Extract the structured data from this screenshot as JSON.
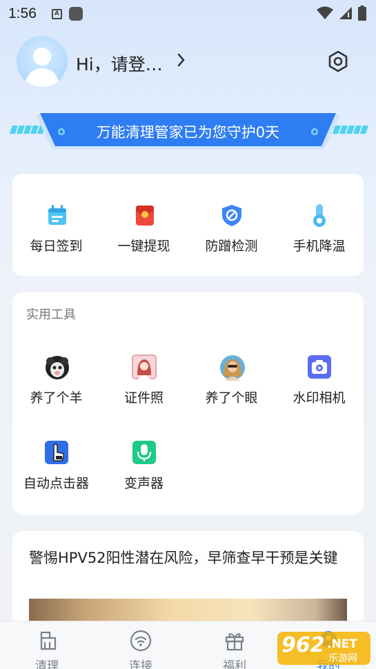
{
  "status_bar": {
    "time": "1:56",
    "notif_letter": "A"
  },
  "profile": {
    "greeting": "Hi，请登…"
  },
  "banner": {
    "text": "万能清理管家已为您守护0天"
  },
  "quick_actions": [
    {
      "label": "每日签到",
      "icon": "calendar-icon"
    },
    {
      "label": "一键提现",
      "icon": "red-envelope-icon"
    },
    {
      "label": "防蹭检测",
      "icon": "shield-icon"
    },
    {
      "label": "手机降温",
      "icon": "thermometer-icon"
    }
  ],
  "tools": {
    "title": "实用工具",
    "items": [
      {
        "label": "养了个羊",
        "icon": "sheep-icon"
      },
      {
        "label": "证件照",
        "icon": "id-photo-icon"
      },
      {
        "label": "养了个眼",
        "icon": "portrait-icon"
      },
      {
        "label": "水印相机",
        "icon": "camera-icon"
      },
      {
        "label": "自动点击器",
        "icon": "auto-clicker-icon"
      },
      {
        "label": "变声器",
        "icon": "microphone-icon"
      }
    ]
  },
  "news": {
    "title": "警惕HPV52阳性潜在风险，早筛查早干预是关键"
  },
  "tabbar": {
    "tabs": [
      {
        "label": "清理",
        "icon": "broom-icon"
      },
      {
        "label": "连接",
        "icon": "wifi-icon"
      },
      {
        "label": "福利",
        "icon": "gift-icon"
      },
      {
        "label": "我的",
        "icon": "profile-icon"
      }
    ]
  },
  "watermark": {
    "brand": "962",
    "suffix": ".NET",
    "subtitle": "乐游网"
  },
  "colors": {
    "accent": "#2a7cf6",
    "banner_blue": "#2f7df3",
    "background": "#e6effc"
  }
}
